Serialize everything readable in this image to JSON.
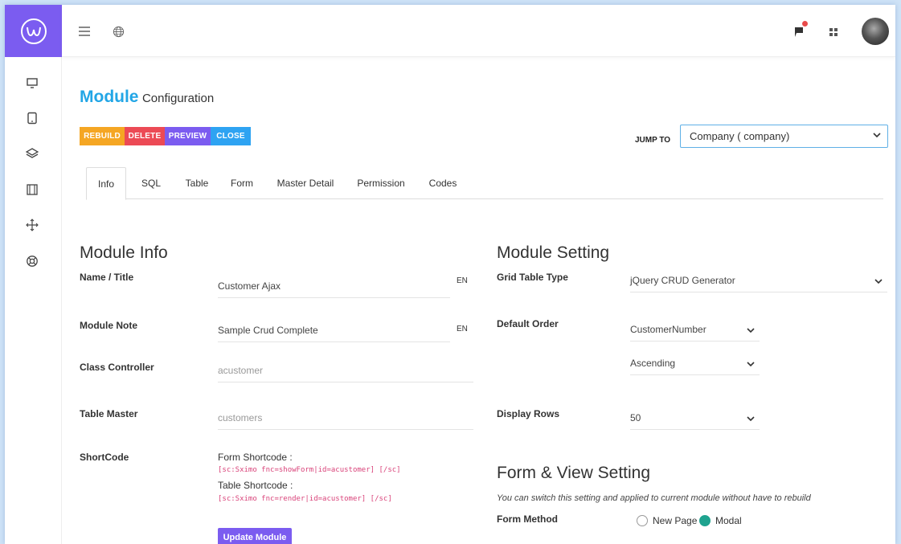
{
  "topbar": {
    "menu_icon": "hamburger-icon",
    "globe_icon": "globe-icon",
    "notification_icon": "flag-icon",
    "apps_icon": "grid-icon"
  },
  "sidebar": {
    "items": [
      {
        "icon": "monitor-icon"
      },
      {
        "icon": "tablet-icon"
      },
      {
        "icon": "layers-icon"
      },
      {
        "icon": "film-icon"
      },
      {
        "icon": "move-icon"
      },
      {
        "icon": "lifebuoy-icon"
      }
    ]
  },
  "header": {
    "title_main": "Module",
    "title_sub": "Configuration"
  },
  "toolbar": {
    "rebuild": "REBUILD",
    "delete": "DELETE",
    "preview": "PREVIEW",
    "close": "CLOSE"
  },
  "jump": {
    "label": "JUMP TO",
    "selected": "Company ( company)"
  },
  "tabs": [
    "Info",
    "SQL",
    "Table",
    "Form",
    "Master Detail",
    "Permission",
    "Codes"
  ],
  "module_info": {
    "title": "Module Info",
    "name_label": "Name / Title",
    "name_value": "Customer Ajax",
    "name_lang": "EN",
    "note_label": "Module Note",
    "note_value": "Sample Crud Complete",
    "note_lang": "EN",
    "controller_label": "Class Controller",
    "controller_value": "acustomer",
    "table_label": "Table Master",
    "table_value": "customers",
    "shortcode_label": "ShortCode",
    "form_shortcode_label": "Form Shortcode :",
    "form_shortcode": "[sc:Sximo fnc=showForm|id=acustomer] [/sc]",
    "table_shortcode_label": "Table Shortcode :",
    "table_shortcode": "[sc:Sximo fnc=render|id=acustomer] [/sc]",
    "update_button": "Update Module"
  },
  "module_setting": {
    "title": "Module Setting",
    "grid_label": "Grid Table Type",
    "grid_value": "jQuery CRUD Generator",
    "order_label": "Default Order",
    "order_field": "CustomerNumber",
    "order_dir": "Ascending",
    "rows_label": "Display Rows",
    "rows_value": "50"
  },
  "form_view": {
    "title": "Form & View Setting",
    "note": "You can switch this setting and applied to current module without have to rebuild",
    "method_label": "Form Method",
    "option_new_page": "New Page",
    "option_modal": "Modal",
    "selected": "Modal"
  },
  "colors": {
    "brand": "#7b5cf0",
    "title": "#22a6e6",
    "rebuild": "#f5a623",
    "delete": "#ec4a55",
    "preview": "#7b5cf0",
    "close": "#2ea3f2",
    "radio_on": "#1fa38f"
  }
}
